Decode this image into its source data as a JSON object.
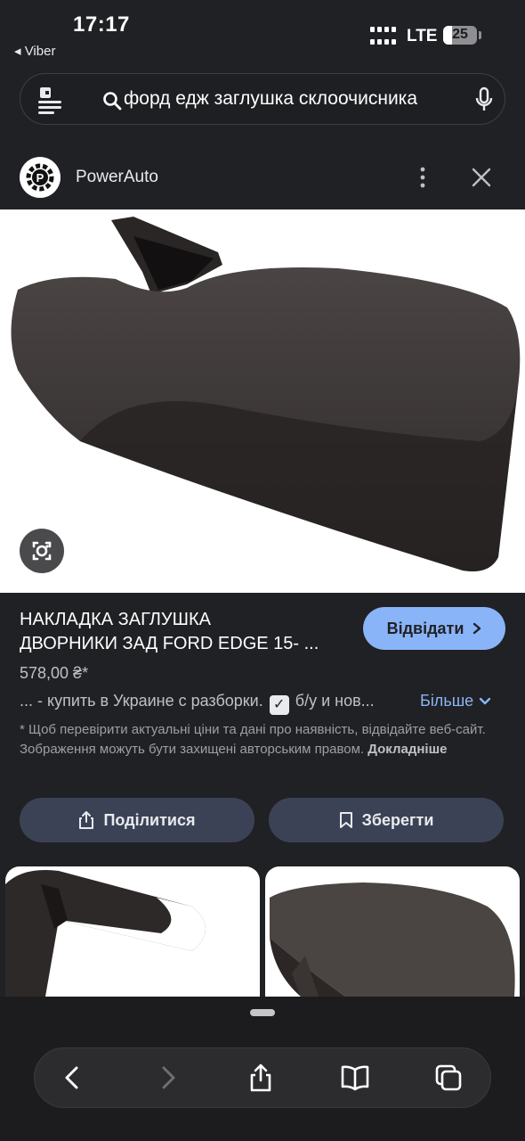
{
  "status_bar": {
    "time": "17:17",
    "back_app": "◂ Viber",
    "network": "LTE",
    "battery": "25",
    "battery_level": 0.25
  },
  "search": {
    "query": "форд едж заглушка склоочисника",
    "left_icon": "lens-menu-icon",
    "search_icon": "search-icon",
    "voice_icon": "microphone-icon"
  },
  "source": {
    "name": "PowerAuto",
    "more_icon": "more-vert-icon",
    "close_icon": "close-icon"
  },
  "product": {
    "title_line1": "НАКЛАДКА ЗАГЛУШКА",
    "title_line2": "ДВОРНИКИ ЗАД FORD EDGE 15- ...",
    "visit_label": "Відвідати",
    "price": "578,00 ₴*",
    "desc_before": "... - купить в Украине с разборки.",
    "desc_check": "✓",
    "desc_after": "б/у и нов...",
    "more_label": "Більше",
    "disclaimer": "* Щоб перевірити актуальні ціни та дані про наявність, відвідайте веб-сайт. Зображення можуть бути захищені авторським правом.",
    "disclaimer_link": "Докладніше"
  },
  "actions": {
    "share_label": "Поділитися",
    "save_label": "Зберегти"
  },
  "toolbar": {
    "icons": [
      "back-icon",
      "forward-icon",
      "share-icon",
      "bookmarks-icon",
      "tabs-icon"
    ]
  },
  "colors": {
    "background": "#202124",
    "accent": "#8ab4f8",
    "button_bg": "#3c4256"
  }
}
